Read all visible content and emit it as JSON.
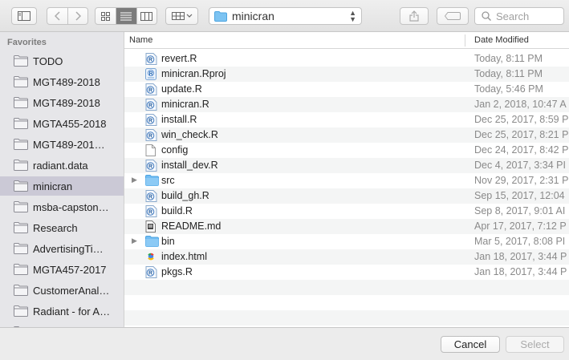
{
  "toolbar": {
    "path_label": "minicran",
    "search_placeholder": "Search"
  },
  "sidebar": {
    "heading": "Favorites",
    "items": [
      {
        "label": "TODO"
      },
      {
        "label": "MGT489-2018"
      },
      {
        "label": "MGT489-2018"
      },
      {
        "label": "MGTA455-2018"
      },
      {
        "label": "MGT489-201…"
      },
      {
        "label": "radiant.data"
      },
      {
        "label": "minicran",
        "selected": true
      },
      {
        "label": "msba-capston…"
      },
      {
        "label": "Research"
      },
      {
        "label": "AdvertisingTi…"
      },
      {
        "label": "MGTA457-2017"
      },
      {
        "label": "CustomerAnal…"
      },
      {
        "label": "Radiant - for A…"
      }
    ]
  },
  "columns": {
    "name": "Name",
    "date": "Date Modified"
  },
  "files": [
    {
      "name": "revert.R",
      "date": "Today, 8:11 PM",
      "icon": "r-file-icon"
    },
    {
      "name": "minicran.Rproj",
      "date": "Today, 8:11 PM",
      "icon": "rproj-file-icon"
    },
    {
      "name": "update.R",
      "date": "Today, 5:46 PM",
      "icon": "r-file-icon"
    },
    {
      "name": "minicran.R",
      "date": "Jan 2, 2018, 10:47 A",
      "icon": "r-file-icon"
    },
    {
      "name": "install.R",
      "date": "Dec 25, 2017, 8:59 P",
      "icon": "r-file-icon"
    },
    {
      "name": "win_check.R",
      "date": "Dec 25, 2017, 8:21 P",
      "icon": "r-file-icon"
    },
    {
      "name": "config",
      "date": "Dec 24, 2017, 8:42 P",
      "icon": "document-icon"
    },
    {
      "name": "install_dev.R",
      "date": "Dec 4, 2017, 3:34 PI",
      "icon": "r-file-icon"
    },
    {
      "name": "src",
      "date": "Nov 29, 2017, 2:31 P",
      "icon": "folder-icon",
      "disclosure": true
    },
    {
      "name": "build_gh.R",
      "date": "Sep 15, 2017, 12:04",
      "icon": "r-file-icon"
    },
    {
      "name": "build.R",
      "date": "Sep 8, 2017, 9:01 AI",
      "icon": "r-file-icon"
    },
    {
      "name": "README.md",
      "date": "Apr 17, 2017, 7:12 P",
      "icon": "markdown-file-icon"
    },
    {
      "name": "bin",
      "date": "Mar 5, 2017, 8:08 PI",
      "icon": "folder-icon",
      "disclosure": true
    },
    {
      "name": "index.html",
      "date": "Jan 18, 2017, 3:44 P",
      "icon": "html-file-icon"
    },
    {
      "name": "pkgs.R",
      "date": "Jan 18, 2017, 3:44 P",
      "icon": "r-file-icon"
    }
  ],
  "buttons": {
    "cancel": "Cancel",
    "select": "Select"
  },
  "colors": {
    "selection": "#cbc9d6",
    "folder": "#5ab4f0"
  }
}
